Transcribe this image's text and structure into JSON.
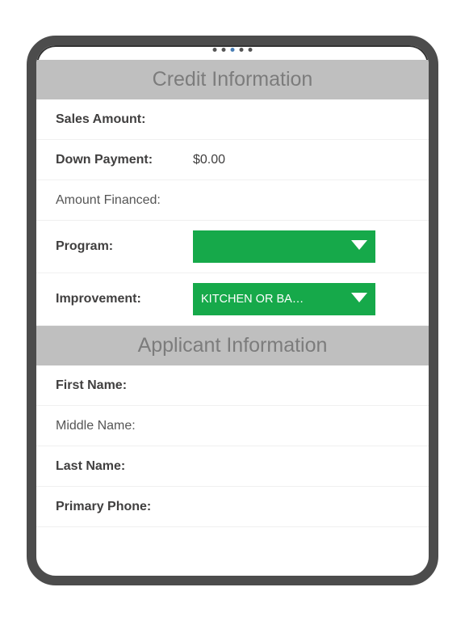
{
  "sections": {
    "credit": {
      "title": "Credit Information"
    },
    "applicant": {
      "title": "Applicant Information"
    }
  },
  "credit": {
    "sales_amount": {
      "label": "Sales Amount:",
      "value": ""
    },
    "down_payment": {
      "label": "Down Payment:",
      "value": "$0.00"
    },
    "amount_financed": {
      "label": "Amount Financed:",
      "value": ""
    },
    "program": {
      "label": "Program:",
      "selected": ""
    },
    "improvement": {
      "label": "Improvement:",
      "selected": "KITCHEN OR BA…"
    }
  },
  "applicant": {
    "first_name": {
      "label": "First Name:",
      "value": ""
    },
    "middle_name": {
      "label": "Middle Name:",
      "value": ""
    },
    "last_name": {
      "label": "Last Name:",
      "value": ""
    },
    "primary_phone": {
      "label": "Primary Phone:",
      "value": ""
    }
  },
  "colors": {
    "accent": "#16a94a",
    "header_bg": "#bfbfbf",
    "header_fg": "#7c7c7c"
  }
}
